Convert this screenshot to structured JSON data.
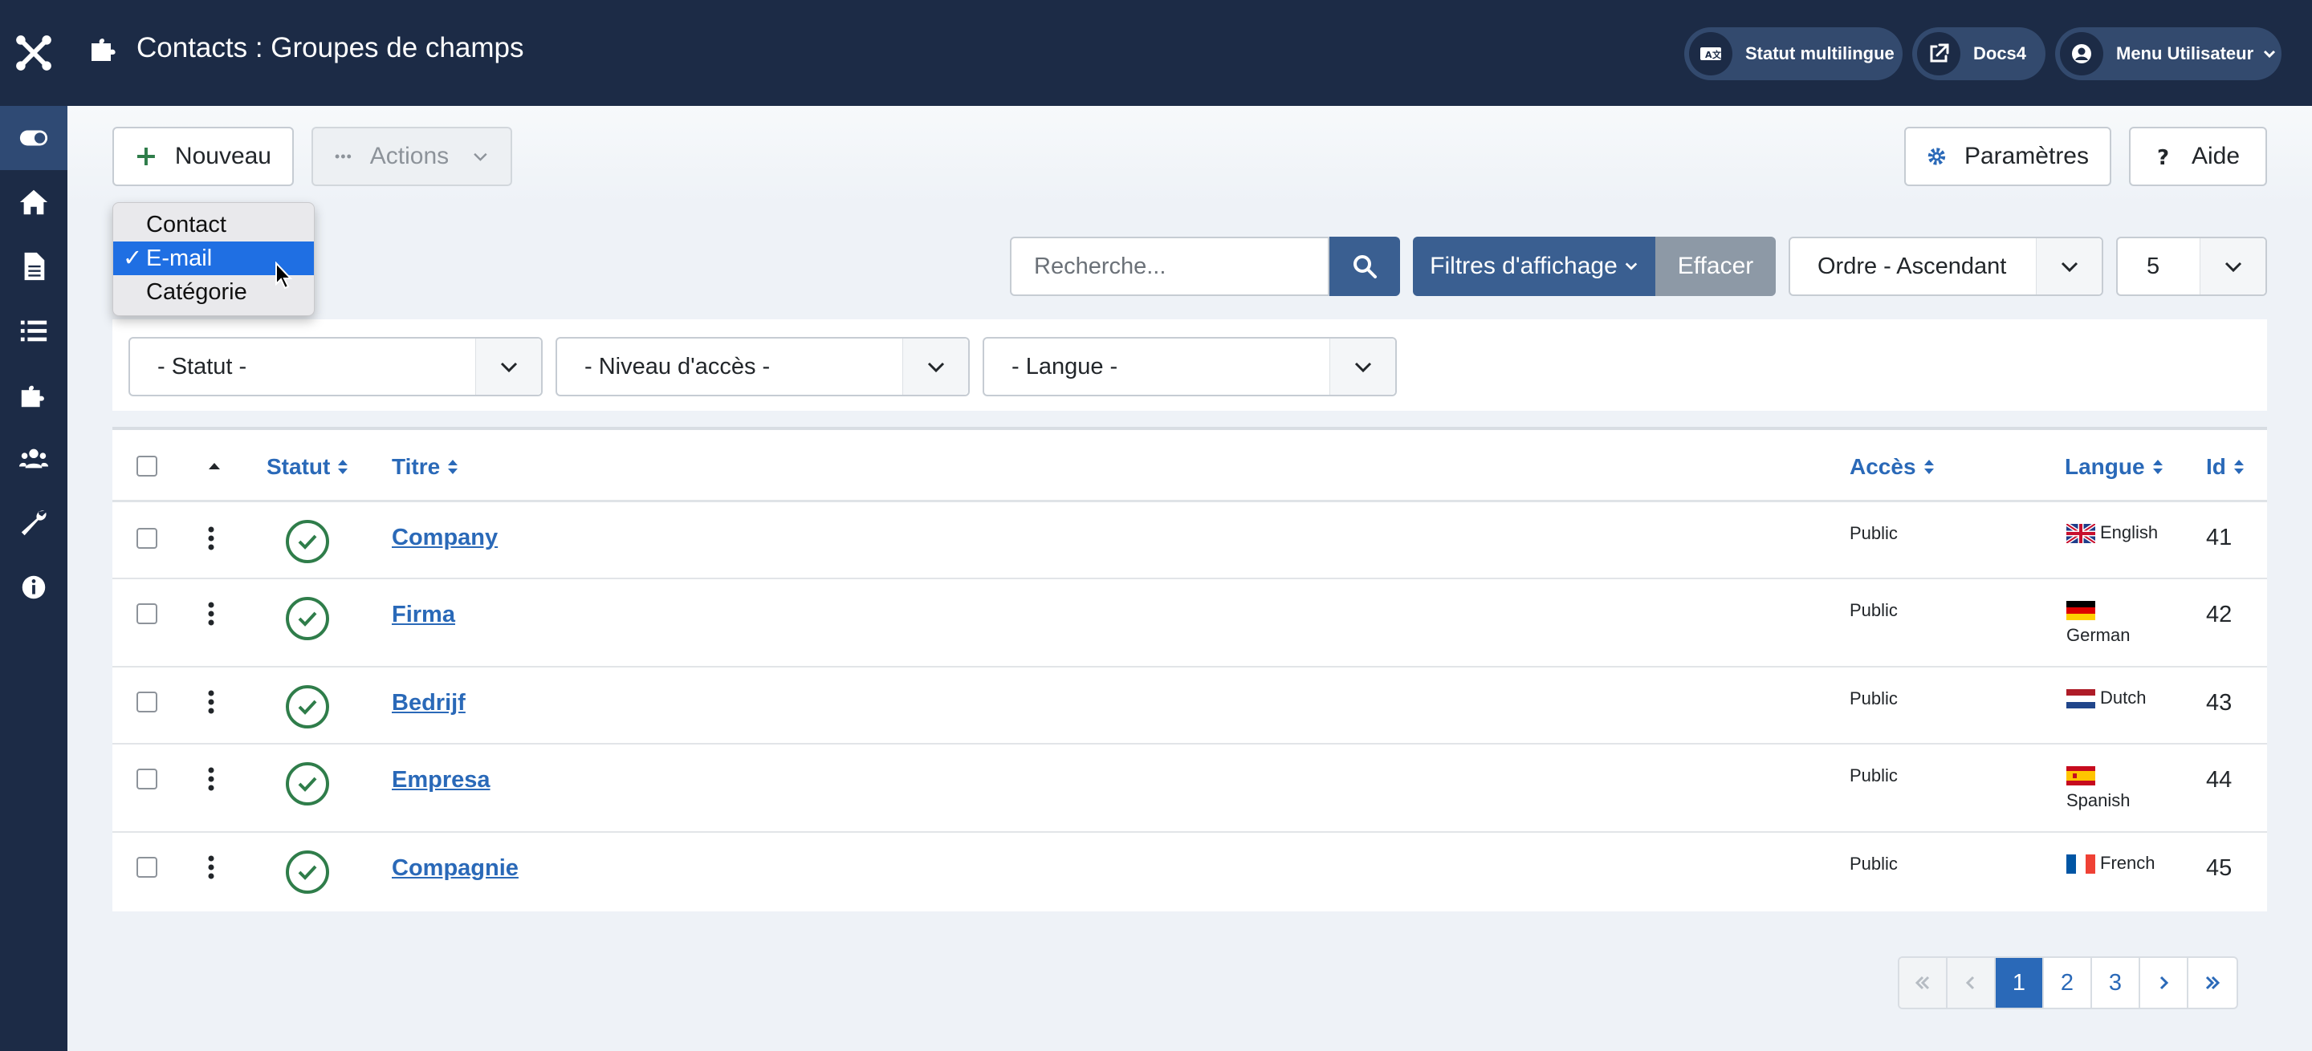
{
  "header": {
    "title": "Contacts : Groupes de champs",
    "multilingual_label": "Statut multilingue",
    "docs_label": "Docs4",
    "user_menu_label": "Menu Utilisateur"
  },
  "sidebar": {
    "items": [
      "toggle-icon",
      "home-icon",
      "file-icon",
      "list-icon",
      "puzzle-icon",
      "users-icon",
      "wrench-icon",
      "info-icon"
    ]
  },
  "toolbar": {
    "new_label": "Nouveau",
    "actions_label": "Actions",
    "params_label": "Paramètres",
    "help_label": "Aide"
  },
  "context_dropdown": {
    "options": [
      "Contact",
      "E-mail",
      "Catégorie"
    ],
    "selected": "E-mail",
    "check": "✓"
  },
  "search": {
    "placeholder": "Recherche...",
    "filters_label": "Filtres d'affichage",
    "clear_label": "Effacer",
    "ordering_value": "Ordre - Ascendant",
    "limit_value": "5"
  },
  "filters": {
    "status": "- Statut -",
    "access": "- Niveau d'accès -",
    "language": "- Langue -"
  },
  "table": {
    "columns": {
      "status": "Statut",
      "title": "Titre",
      "access": "Accès",
      "language": "Langue",
      "id": "Id"
    },
    "rows": [
      {
        "title": "Company",
        "access": "Public",
        "language": "English",
        "id": "41"
      },
      {
        "title": "Firma",
        "access": "Public",
        "language": "German",
        "id": "42"
      },
      {
        "title": "Bedrijf",
        "access": "Public",
        "language": "Dutch",
        "id": "43"
      },
      {
        "title": "Empresa",
        "access": "Public",
        "language": "Spanish",
        "id": "44"
      },
      {
        "title": "Compagnie",
        "access": "Public",
        "language": "French",
        "id": "45"
      }
    ]
  },
  "pagination": {
    "pages": [
      "1",
      "2",
      "3"
    ],
    "current": "1"
  },
  "colors": {
    "header_bg": "#1c2b46",
    "accent_blue": "#2a69b8",
    "button_blue": "#3a5f91",
    "status_green": "#2f7d4a"
  }
}
